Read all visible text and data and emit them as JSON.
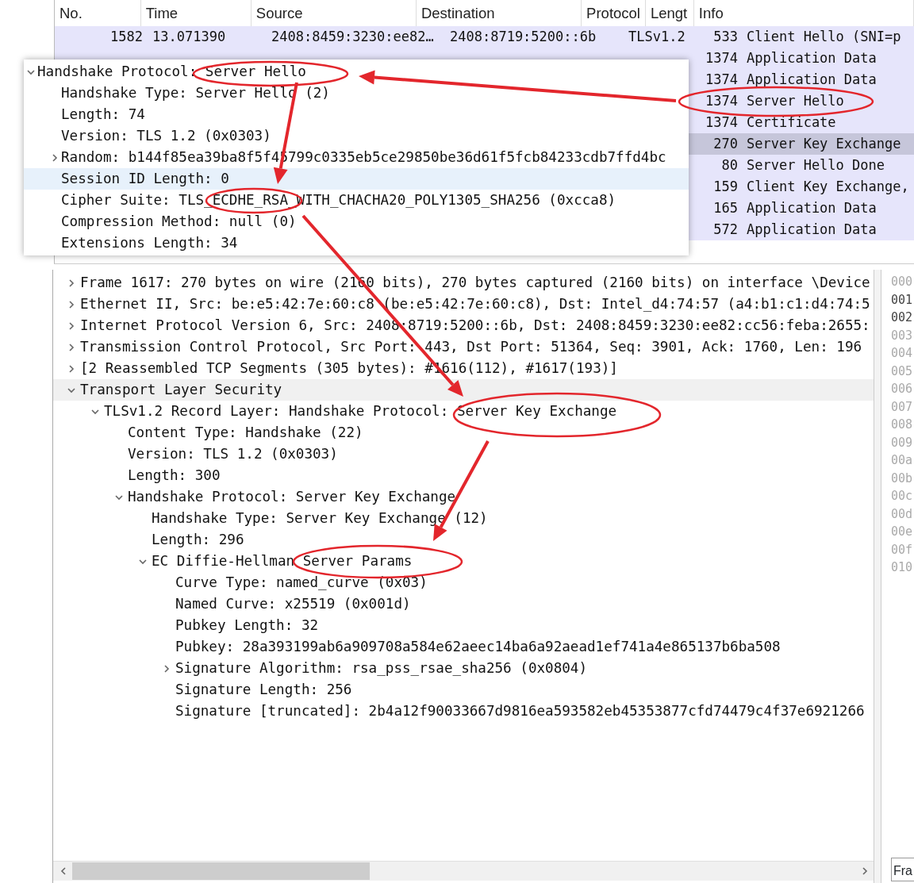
{
  "packet_list": {
    "columns": [
      "No.",
      "Time",
      "Source",
      "Destination",
      "Protocol",
      "Lengt",
      "Info"
    ],
    "rows": [
      {
        "no": "1582",
        "time": "13.071390",
        "source": "2408:8459:3230:ee82…",
        "destination": "2408:8719:5200::6b",
        "protocol": "TLSv1.2",
        "length": "533",
        "info": "Client Hello (SNI=p",
        "selected": false
      },
      {
        "length": "1374",
        "info": "Application Data",
        "selected": false
      },
      {
        "length": "1374",
        "info": "Application Data",
        "selected": false
      },
      {
        "length": "1374",
        "info": "Server Hello",
        "selected": false
      },
      {
        "length": "1374",
        "info": "Certificate",
        "selected": false
      },
      {
        "length": "270",
        "info": "Server Key Exchange",
        "selected": true
      },
      {
        "length": "80",
        "info": "Server Hello Done",
        "selected": false
      },
      {
        "length": "159",
        "info": "Client Key Exchange,",
        "selected": false
      },
      {
        "length": "165",
        "info": "Application Data",
        "selected": false
      },
      {
        "length": "572",
        "info": "Application Data",
        "selected": false
      }
    ]
  },
  "popup": {
    "tree": [
      {
        "text": "Handshake Protocol: Server Hello",
        "expanded": true,
        "selected": false,
        "children": [
          {
            "text": "Handshake Type: Server Hello (2)",
            "selected": false
          },
          {
            "text": "Length: 74",
            "selected": false
          },
          {
            "text": "Version: TLS 1.2 (0x0303)",
            "selected": false
          },
          {
            "text": "Random: b144f85ea39ba8f5f45799c0335eb5ce29850be36d61f5fcb84233cdb7ffd4bc",
            "expanded": false,
            "selected": false
          },
          {
            "text": "Session ID Length: 0",
            "selected": true
          },
          {
            "text": "Cipher Suite: TLS_ECDHE_RSA_WITH_CHACHA20_POLY1305_SHA256 (0xcca8)",
            "selected": false
          },
          {
            "text": "Compression Method: null (0)",
            "selected": false
          },
          {
            "text": "Extensions Length: 34",
            "selected": false
          }
        ]
      }
    ]
  },
  "details": {
    "tree": [
      {
        "text": "Frame 1617: 270 bytes on wire (2160 bits), 270 bytes captured (2160 bits) on interface \\Device",
        "expanded": false,
        "selected": false
      },
      {
        "text": "Ethernet II, Src: be:e5:42:7e:60:c8 (be:e5:42:7e:60:c8), Dst: Intel_d4:74:57 (a4:b1:c1:d4:74:5",
        "expanded": false,
        "selected": false
      },
      {
        "text": "Internet Protocol Version 6, Src: 2408:8719:5200::6b, Dst: 2408:8459:3230:ee82:cc56:feba:2655:",
        "expanded": false,
        "selected": false
      },
      {
        "text": "Transmission Control Protocol, Src Port: 443, Dst Port: 51364, Seq: 3901, Ack: 1760, Len: 196",
        "expanded": false,
        "selected": false
      },
      {
        "text": "[2 Reassembled TCP Segments (305 bytes): #1616(112), #1617(193)]",
        "expanded": false,
        "selected": false
      },
      {
        "text": "Transport Layer Security",
        "expanded": true,
        "selected": true,
        "children": [
          {
            "text": "TLSv1.2 Record Layer: Handshake Protocol: Server Key Exchange",
            "expanded": true,
            "selected": false,
            "children": [
              {
                "text": "Content Type: Handshake (22)",
                "selected": false
              },
              {
                "text": "Version: TLS 1.2 (0x0303)",
                "selected": false
              },
              {
                "text": "Length: 300",
                "selected": false
              },
              {
                "text": "Handshake Protocol: Server Key Exchange",
                "expanded": true,
                "selected": false,
                "children": [
                  {
                    "text": "Handshake Type: Server Key Exchange (12)",
                    "selected": false
                  },
                  {
                    "text": "Length: 296",
                    "selected": false
                  },
                  {
                    "text": "EC Diffie-Hellman Server Params",
                    "expanded": true,
                    "selected": false,
                    "children": [
                      {
                        "text": "Curve Type: named_curve (0x03)",
                        "selected": false
                      },
                      {
                        "text": "Named Curve: x25519 (0x001d)",
                        "selected": false
                      },
                      {
                        "text": "Pubkey Length: 32",
                        "selected": false
                      },
                      {
                        "text": "Pubkey: 28a393199ab6a909708a584e62aeec14ba6a92aead1ef741a4e865137b6ba508",
                        "selected": false
                      },
                      {
                        "text": "Signature Algorithm: rsa_pss_rsae_sha256 (0x0804)",
                        "expanded": false,
                        "selected": false
                      },
                      {
                        "text": "Signature Length: 256",
                        "selected": false
                      },
                      {
                        "text": "Signature [truncated]: 2b4a12f90033667d9816ea593582eb45353877cfd74479c4f37e6921266",
                        "selected": false
                      }
                    ]
                  }
                ]
              }
            ]
          }
        ]
      }
    ]
  },
  "hex_offsets": [
    {
      "text": "000",
      "highlighted": false
    },
    {
      "text": "001",
      "highlighted": true
    },
    {
      "text": "002",
      "highlighted": true
    },
    {
      "text": "003",
      "highlighted": false
    },
    {
      "text": "004",
      "highlighted": false
    },
    {
      "text": "005",
      "highlighted": false
    },
    {
      "text": "006",
      "highlighted": false
    },
    {
      "text": "007",
      "highlighted": false
    },
    {
      "text": "008",
      "highlighted": false
    },
    {
      "text": "009",
      "highlighted": false
    },
    {
      "text": "00a",
      "highlighted": false
    },
    {
      "text": "00b",
      "highlighted": false
    },
    {
      "text": "00c",
      "highlighted": false
    },
    {
      "text": "00d",
      "highlighted": false
    },
    {
      "text": "00e",
      "highlighted": false
    },
    {
      "text": "00f",
      "highlighted": false
    },
    {
      "text": "010",
      "highlighted": false
    }
  ],
  "bottom_tab": {
    "label": "Fra"
  }
}
